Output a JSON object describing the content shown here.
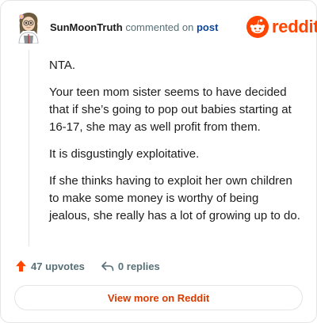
{
  "header": {
    "username": "SunMoonTruth",
    "action_text": "commented on",
    "link_text": "post",
    "brand_icon": "reddit-snoo-icon",
    "brand_wordmark": "reddit"
  },
  "comment": {
    "paragraphs": [
      "NTA.",
      "Your teen mom sister seems to have decided that if she’s going to pop out babies starting at 16-17, she may as well profit from them.",
      "It is disgustingly exploitative.",
      "If she thinks having to exploit her own children to make some money is worthy of being jealous, she really has a lot of growing up to do."
    ]
  },
  "actions": {
    "upvotes_label": "47 upvotes",
    "replies_label": "0 replies",
    "upvote_icon": "arrow-up-icon",
    "reply_icon": "reply-arrow-icon"
  },
  "footer": {
    "view_more_label": "View more on Reddit"
  },
  "colors": {
    "brand": "#ff4500",
    "link": "#0a449b",
    "muted": "#576f76",
    "text": "#1c1c1c",
    "view_more": "#d93a00"
  }
}
